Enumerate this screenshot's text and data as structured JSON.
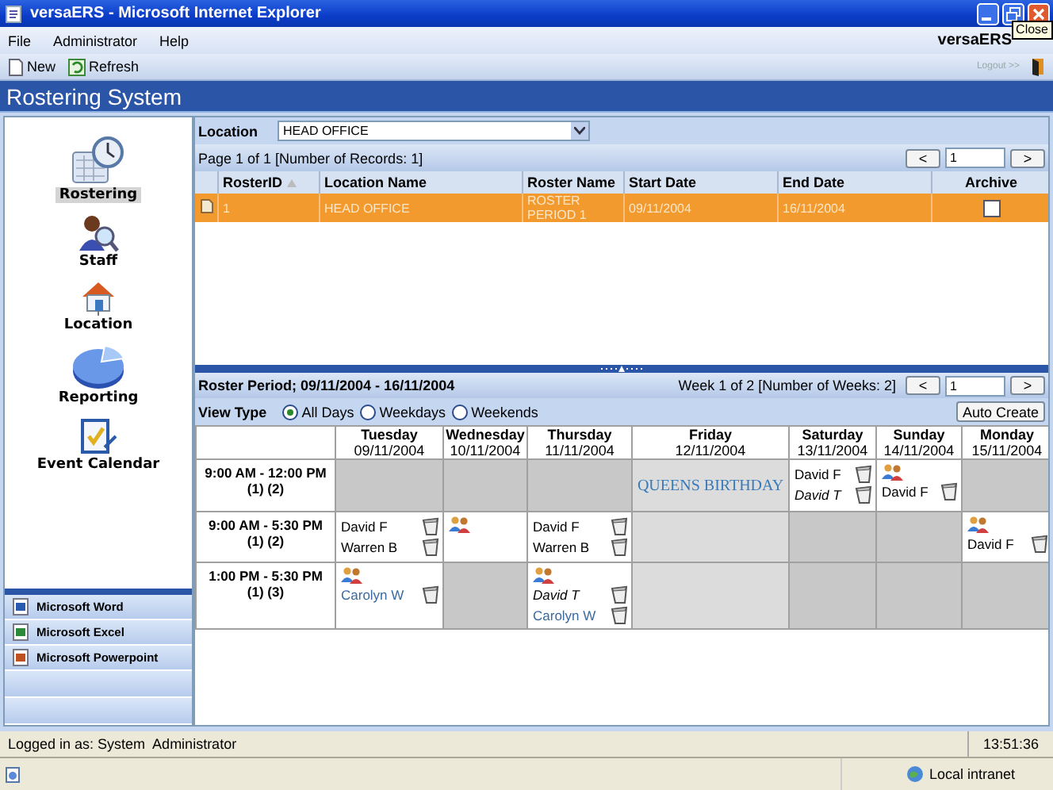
{
  "window": {
    "title": "versaERS - Microsoft Internet Explorer",
    "tooltip": "Close"
  },
  "menu": {
    "items": [
      "File",
      "Administrator",
      "Help"
    ],
    "brand": "versaERS"
  },
  "toolbar": {
    "buttons": [
      "New",
      "Refresh"
    ],
    "logout": "Logout >>"
  },
  "header": {
    "title": "Rostering System"
  },
  "sidebar": {
    "items": [
      {
        "label": "Rostering",
        "selected": true
      },
      {
        "label": "Staff",
        "selected": false
      },
      {
        "label": "Location",
        "selected": false
      },
      {
        "label": "Reporting",
        "selected": false
      },
      {
        "label": "Event Calendar",
        "selected": false
      }
    ],
    "links": [
      "Microsoft Word",
      "Microsoft Excel",
      "Microsoft Powerpoint"
    ]
  },
  "roster_table": {
    "location_label": "Location",
    "location": "HEAD OFFICE",
    "page_info": "Page 1 of 1 [Number of Records: 1]",
    "prev": "<",
    "page": "1",
    "next": ">",
    "columns": [
      "RosterID",
      "Location Name",
      "Roster Name",
      "Start Date",
      "End Date",
      "Archive"
    ],
    "rows": [
      {
        "roster_id": "1",
        "location_name": "HEAD OFFICE",
        "roster_name": "ROSTER PERIOD 1",
        "start_date": "09/11/2004",
        "end_date": "16/11/2004",
        "archive": false,
        "selected": true
      }
    ]
  },
  "roster_period": {
    "title": "Roster Period; 09/11/2004 - 16/11/2004",
    "week_info": "Week 1 of 2 [Number of Weeks: 2]",
    "prev": "<",
    "week": "1",
    "next": ">",
    "view_type_label": "View Type",
    "view_types": [
      {
        "label": "All Days",
        "selected": true
      },
      {
        "label": "Weekdays",
        "selected": false
      },
      {
        "label": "Weekends",
        "selected": false
      }
    ],
    "auto_create": "Auto Create"
  },
  "calendar": {
    "days": [
      {
        "name": "Tuesday",
        "date": "09/11/2004"
      },
      {
        "name": "Wednesday",
        "date": "10/11/2004"
      },
      {
        "name": "Thursday",
        "date": "11/11/2004"
      },
      {
        "name": "Friday",
        "date": "12/11/2004"
      },
      {
        "name": "Saturday",
        "date": "13/11/2004"
      },
      {
        "name": "Sunday",
        "date": "14/11/2004"
      },
      {
        "name": "Monday",
        "date": "15/11/2004"
      }
    ],
    "shifts": [
      {
        "time": "9:00 AM - 12:00 PM",
        "counts": "(1) (2)",
        "cells": [
          {
            "kind": "off"
          },
          {
            "kind": "off"
          },
          {
            "kind": "off"
          },
          {
            "kind": "holiday",
            "label": "QUEENS BIRTHDAY"
          },
          {
            "kind": "staff",
            "group_icon": false,
            "entries": [
              {
                "name": "David F",
                "kind": "plain"
              },
              {
                "name": "David T",
                "kind": "italic"
              }
            ]
          },
          {
            "kind": "staff",
            "group_icon": true,
            "entries": [
              {
                "name": "David F",
                "kind": "plain"
              }
            ]
          },
          {
            "kind": "off"
          }
        ]
      },
      {
        "time": "9:00 AM - 5:30 PM",
        "counts": "(1) (2)",
        "cells": [
          {
            "kind": "staff",
            "group_icon": false,
            "entries": [
              {
                "name": "David F",
                "kind": "plain"
              },
              {
                "name": "Warren B",
                "kind": "plain"
              }
            ]
          },
          {
            "kind": "staff",
            "group_icon": true
          },
          {
            "kind": "staff",
            "group_icon": false,
            "entries": [
              {
                "name": "David F",
                "kind": "plain"
              },
              {
                "name": "Warren B",
                "kind": "plain"
              }
            ]
          },
          {
            "kind": "holiday"
          },
          {
            "kind": "off"
          },
          {
            "kind": "off"
          },
          {
            "kind": "staff",
            "group_icon": true,
            "entries": [
              {
                "name": "David F",
                "kind": "plain"
              }
            ]
          }
        ]
      },
      {
        "time": "1:00 PM - 5:30 PM",
        "counts": "(1) (3)",
        "cells": [
          {
            "kind": "staff",
            "group_icon": true,
            "entries": [
              {
                "name": "Carolyn W",
                "kind": "link"
              }
            ]
          },
          {
            "kind": "off"
          },
          {
            "kind": "staff",
            "group_icon": true,
            "entries": [
              {
                "name": "David T",
                "kind": "italic"
              },
              {
                "name": "Carolyn W",
                "kind": "link"
              }
            ]
          },
          {
            "kind": "holiday"
          },
          {
            "kind": "off"
          },
          {
            "kind": "off"
          },
          {
            "kind": "off"
          }
        ]
      }
    ]
  },
  "status": {
    "logged_in": "Logged in as: System  Administrator",
    "time": "13:51:36"
  },
  "browser_status": {
    "zone": "Local intranet"
  }
}
